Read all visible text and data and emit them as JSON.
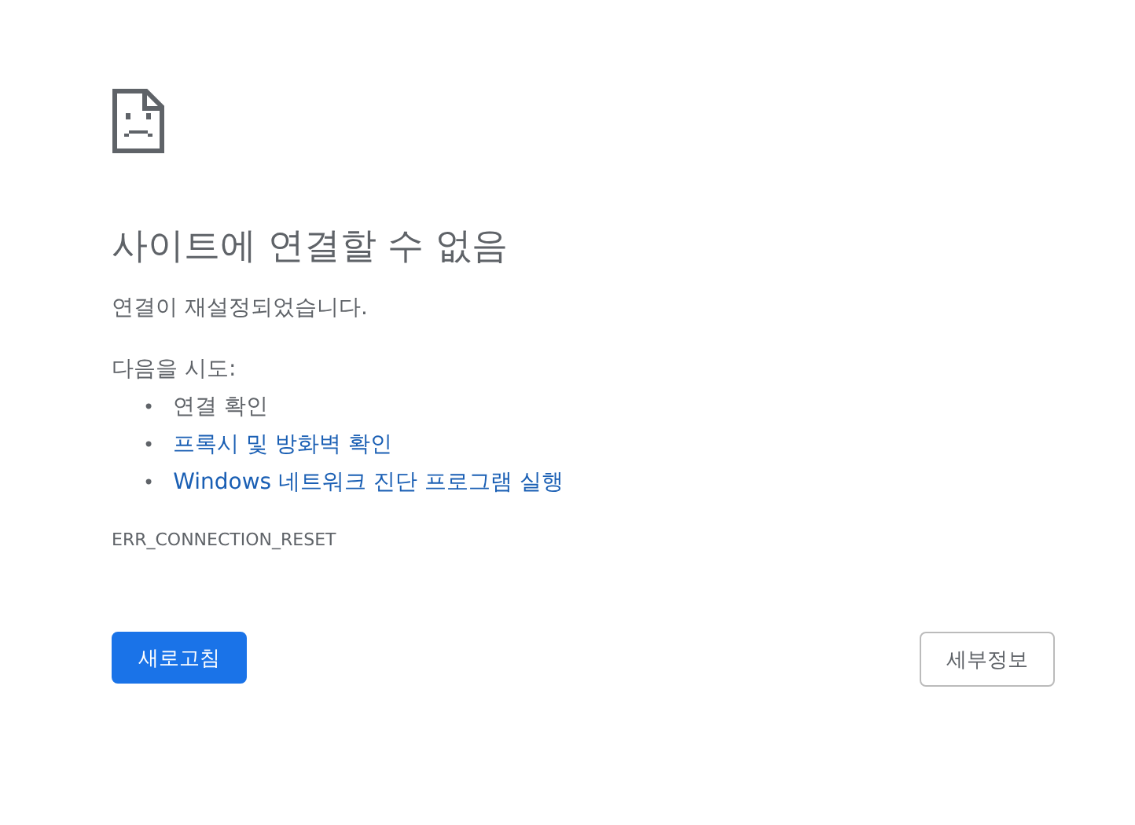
{
  "heading": "사이트에 연결할 수 없음",
  "message": "연결이 재설정되었습니다.",
  "suggestions_intro": "다음을 시도:",
  "suggestions": [
    {
      "kind": "text",
      "bullet": "•",
      "label": "연결 확인"
    },
    {
      "kind": "link",
      "bullet": "•",
      "label": "프록시 및 방화벽 확인"
    },
    {
      "kind": "link",
      "bullet": "•",
      "label": "Windows 네트워크 진단 프로그램 실행"
    }
  ],
  "error_code": "ERR_CONNECTION_RESET",
  "buttons": [
    {
      "kind": "primary",
      "label": "새로고침"
    },
    {
      "kind": "secondary",
      "label": "세부정보"
    }
  ]
}
